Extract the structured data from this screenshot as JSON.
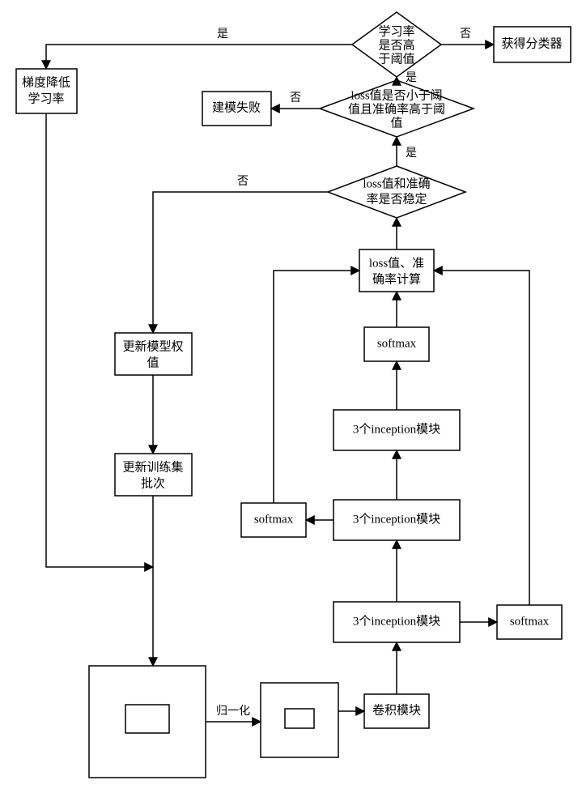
{
  "chart_data": {
    "type": "flowchart",
    "nodes": {
      "d1": {
        "shape": "diamond",
        "label_lines": [
          "学习率",
          "是否高",
          "于阈值"
        ]
      },
      "b_classifier": {
        "shape": "rect",
        "label": "获得分类器"
      },
      "b_lr": {
        "shape": "rect",
        "label_lines": [
          "梯度降低",
          "学习率"
        ]
      },
      "b_fail": {
        "shape": "rect",
        "label": "建模失败"
      },
      "d2": {
        "shape": "diamond",
        "label_lines": [
          "loss值是否小于阈",
          "值且准确率高于阈",
          "值"
        ]
      },
      "d3": {
        "shape": "diamond",
        "label_lines": [
          "loss值和准确",
          "率是否稳定"
        ]
      },
      "b_loss": {
        "shape": "rect",
        "label_lines": [
          "loss值、准",
          "确率计算"
        ]
      },
      "b_sm_top": {
        "shape": "rect",
        "label": "softmax"
      },
      "b_inc_top": {
        "shape": "rect",
        "label": "3个inception模块"
      },
      "b_inc_mid": {
        "shape": "rect",
        "label": "3个inception模块"
      },
      "b_sm_left": {
        "shape": "rect",
        "label": "softmax"
      },
      "b_inc_bot": {
        "shape": "rect",
        "label": "3个inception模块"
      },
      "b_sm_right": {
        "shape": "rect",
        "label": "softmax"
      },
      "b_conv": {
        "shape": "rect",
        "label": "卷积模块"
      },
      "b_update_w": {
        "shape": "rect",
        "label_lines": [
          "更新模型权",
          "值"
        ]
      },
      "b_update_batch": {
        "shape": "rect",
        "label_lines": [
          "更新训练集",
          "批次"
        ]
      },
      "img_big": {
        "shape": "image",
        "label": ""
      },
      "img_small": {
        "shape": "image",
        "label": ""
      }
    },
    "edge_labels": {
      "yes": "是",
      "no": "否",
      "normalize": "归一化"
    }
  }
}
